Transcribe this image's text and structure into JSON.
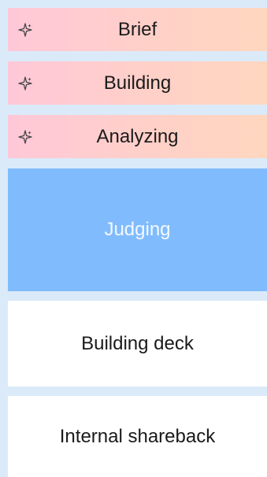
{
  "steps": [
    {
      "label": "Brief",
      "icon": "sparkle-icon",
      "state": "completed"
    },
    {
      "label": "Building",
      "icon": "sparkle-icon",
      "state": "completed"
    },
    {
      "label": "Analyzing",
      "icon": "sparkle-icon",
      "state": "completed"
    },
    {
      "label": "Judging",
      "state": "active"
    },
    {
      "label": "Building deck",
      "state": "pending"
    },
    {
      "label": "Internal shareback",
      "state": "pending"
    }
  ],
  "colors": {
    "background": "#dbeaf9",
    "completed_gradient_start": "#ffc8d8",
    "completed_gradient_end": "#ffd7bf",
    "active": "#80bcfd",
    "pending": "#ffffff"
  }
}
